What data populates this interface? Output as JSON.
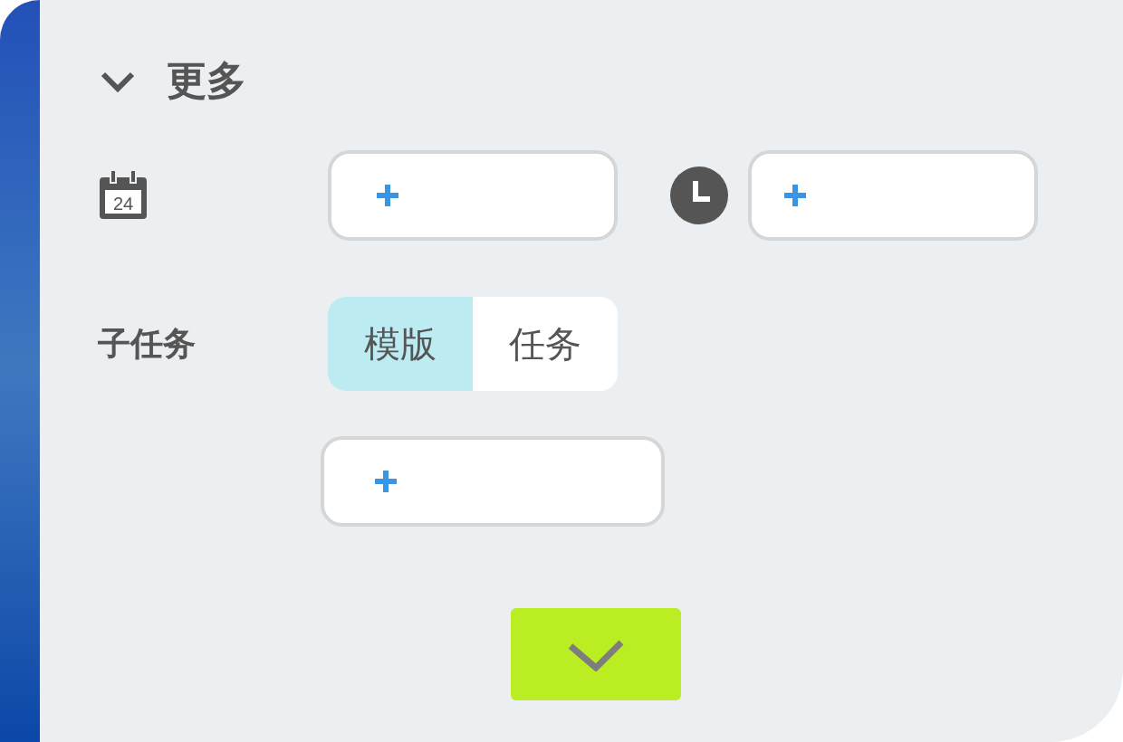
{
  "section": {
    "title": "更多",
    "expanded": true
  },
  "date": {
    "calendar_day": "24"
  },
  "subtasks": {
    "label": "子任务",
    "options": [
      {
        "label": "模版",
        "selected": true
      },
      {
        "label": "任务",
        "selected": false
      }
    ]
  }
}
